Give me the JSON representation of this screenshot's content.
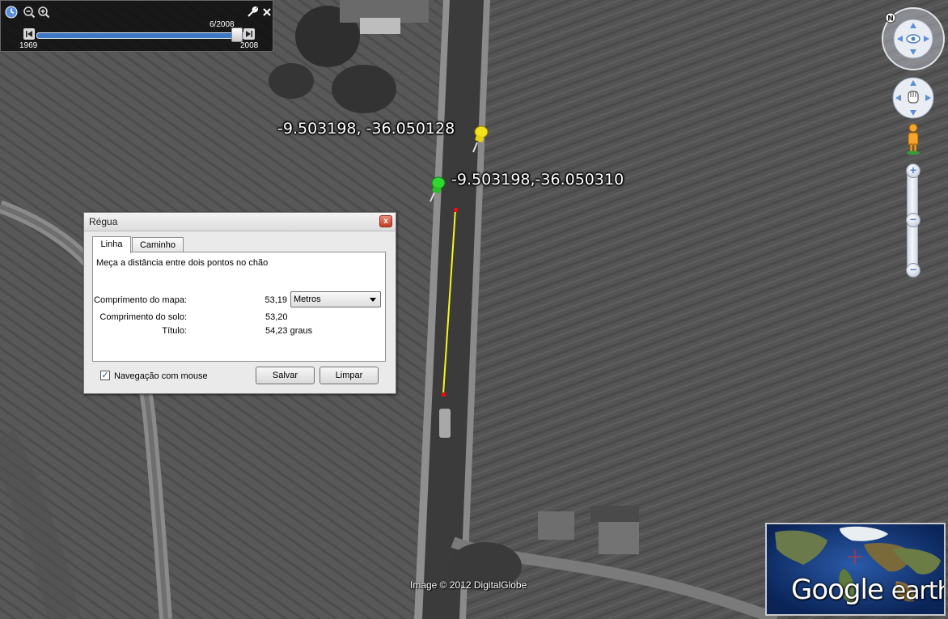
{
  "map": {
    "credit": "Image © 2012 DigitalGlobe",
    "placemarks": [
      {
        "label": "-9.503198, -36.050128",
        "color": "#f2e21a",
        "icon": "yellow-pushpin-icon"
      },
      {
        "label": "-9.503198,-36.050310",
        "color": "#2fd82f",
        "icon": "green-pushpin-icon"
      }
    ],
    "ruler_line_color": "#f5f51e",
    "ruler_endpoint_color": "#e01010"
  },
  "timeslider": {
    "current": "6/2008",
    "start": "1969",
    "end": "2008",
    "position_fraction": 0.97
  },
  "dialog": {
    "title": "Régua",
    "tabs": [
      {
        "label": "Linha",
        "active": true
      },
      {
        "label": "Caminho",
        "active": false
      }
    ],
    "description": "Meça a distância entre dois pontos no chão",
    "map_length_label": "Comprimento do mapa:",
    "map_length_value": "53,19",
    "unit_selected": "Metros",
    "ground_length_label": "Comprimento do solo:",
    "ground_length_value": "53,20",
    "heading_label": "Título:",
    "heading_value": "54,23 graus",
    "mouse_nav_label": "Navegação com mouse",
    "mouse_nav_checked": true,
    "check_mark": "✓",
    "save_label": "Salvar",
    "clear_label": "Limpar",
    "close_glyph": "x"
  },
  "overview": {
    "brand_google": "Google",
    "brand_earth": "earth"
  }
}
